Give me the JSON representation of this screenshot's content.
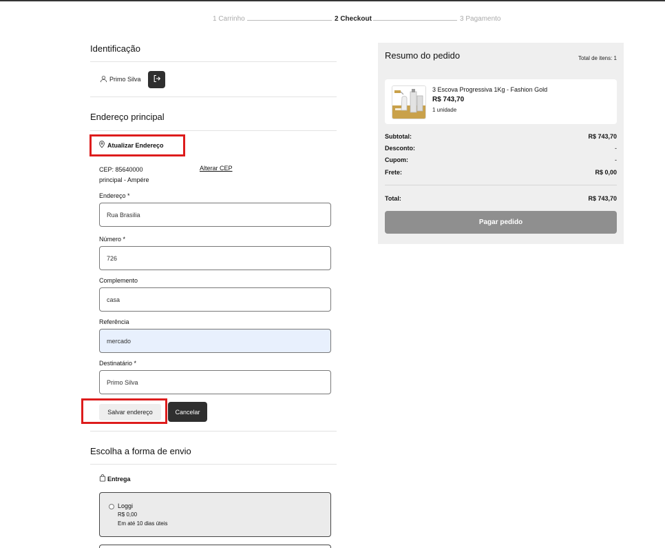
{
  "stepper": {
    "step1": "1 Carrinho",
    "step2": "2 Checkout",
    "step3": "3 Pagamento"
  },
  "identification": {
    "title": "Identificação",
    "user_name": "Primo Silva"
  },
  "address": {
    "title": "Endereço principal",
    "update_label": "Atualizar Endereço",
    "cep_line": "CEP: 85640000",
    "city_line": "principal - Ampére",
    "change_cep": "Alterar CEP",
    "fields": [
      {
        "label": "Endereço *",
        "value": "Rua Brasilia"
      },
      {
        "label": "Número *",
        "value": "726"
      },
      {
        "label": "Complemento",
        "value": "casa"
      },
      {
        "label": "Referência",
        "value": "mercado"
      },
      {
        "label": "Destinatário *",
        "value": "Primo Silva"
      }
    ],
    "save_label": "Salvar endereço",
    "cancel_label": "Cancelar"
  },
  "shipping": {
    "title": "Escolha a forma de envio",
    "delivery_label": "Entrega",
    "options": [
      {
        "name": "Loggi",
        "price": "R$ 0,00",
        "eta": "Em até 10 dias úteis"
      }
    ]
  },
  "summary": {
    "title": "Resumo do pedido",
    "total_items": "Total de itens: 1",
    "product": {
      "name": "3 Escova Progressiva 1Kg - Fashion Gold",
      "price": "R$ 743,70",
      "qty": "1 unidade"
    },
    "rows": [
      {
        "key": "Subtotal:",
        "value": "R$ 743,70"
      },
      {
        "key": "Desconto:",
        "value": "-"
      },
      {
        "key": "Cupom:",
        "value": "-"
      },
      {
        "key": "Frete:",
        "value": "R$ 0,00"
      }
    ],
    "total_key": "Total:",
    "total_value": "R$ 743,70",
    "pay_label": "Pagar pedido"
  },
  "colors": {
    "highlight": "#dd1c1c",
    "dark_button": "#2f2f2f",
    "pay_button": "#8f8f8f",
    "autofill": "#e8f0fd"
  }
}
